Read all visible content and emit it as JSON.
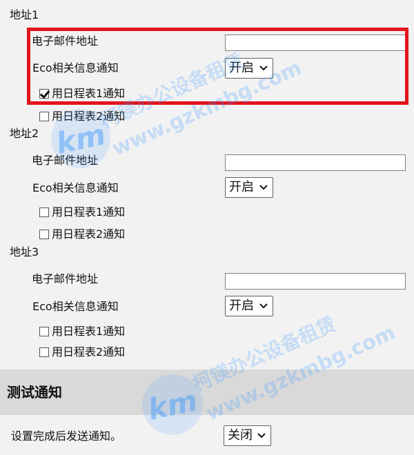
{
  "addresses": [
    {
      "heading": "地址1",
      "email_label": "电子邮件地址",
      "email_value": "",
      "eco_label": "Eco相关信息通知",
      "eco_option": "开启",
      "schedule1_label": "用日程表1通知",
      "schedule1_checked": true,
      "schedule2_label": "用日程表2通知",
      "schedule2_checked": false
    },
    {
      "heading": "地址2",
      "email_label": "电子邮件地址",
      "email_value": "",
      "eco_label": "Eco相关信息通知",
      "eco_option": "开启",
      "schedule1_label": "用日程表1通知",
      "schedule1_checked": false,
      "schedule2_label": "用日程表2通知",
      "schedule2_checked": false
    },
    {
      "heading": "地址3",
      "email_label": "电子邮件地址",
      "email_value": "",
      "eco_label": "Eco相关信息通知",
      "eco_option": "开启",
      "schedule1_label": "用日程表1通知",
      "schedule1_checked": false,
      "schedule2_label": "用日程表2通知",
      "schedule2_checked": false
    }
  ],
  "test_section": {
    "title": "测试通知",
    "send_label": "设置完成后发送通知。",
    "send_option": "关闭"
  },
  "watermark": {
    "logo_text": "km",
    "brand_text": "柯镁办公设备租赁",
    "url_text": "www.gzkmbg.com",
    "color": "#3996ff"
  },
  "colors": {
    "highlight": "#e1141b",
    "background": "#f2f2f2",
    "section_band": "#d9d9d9"
  }
}
